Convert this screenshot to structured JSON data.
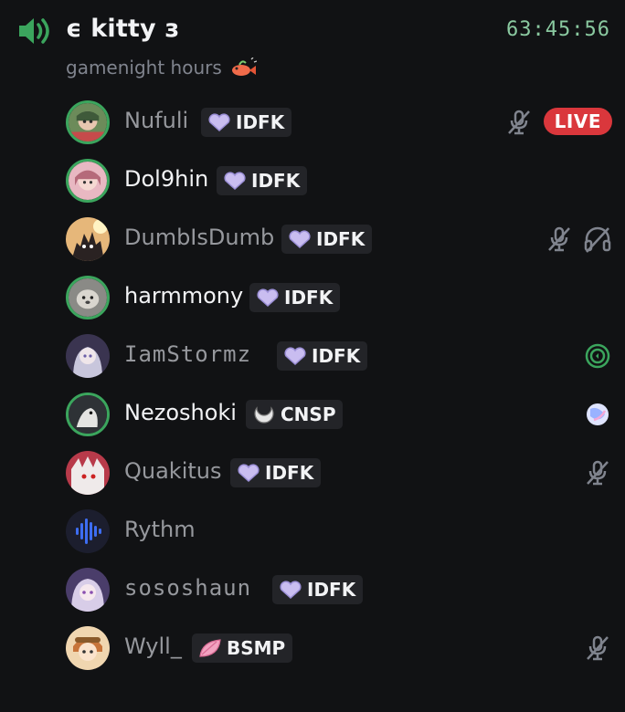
{
  "channel": {
    "name": "ϵ kitty з",
    "status": "gamenight hours",
    "timer": "63:45:56"
  },
  "users": [
    {
      "name": "Nufuli",
      "tag": "IDFK",
      "live": "LIVE"
    },
    {
      "name": "Dol9hin",
      "tag": "IDFK"
    },
    {
      "name": "DumbIsDumb",
      "tag": "IDFK"
    },
    {
      "name": "harmmony",
      "tag": "IDFK"
    },
    {
      "name": "IamStormz",
      "tag": "IDFK"
    },
    {
      "name": "Nezoshoki",
      "tag": "CNSP"
    },
    {
      "name": "Quakitus",
      "tag": "IDFK"
    },
    {
      "name": "Rythm"
    },
    {
      "name": "sososhaun",
      "tag": "IDFK"
    },
    {
      "name": "Wyll_",
      "tag": "BSMP"
    }
  ],
  "colors": {
    "background": "#111214",
    "speaking_ring": "#3ba55d",
    "live_badge": "#da373c",
    "timer": "#8ac9a0",
    "tag_heart": "#c9bdf0",
    "tag_bsmp": "#f2a2c0"
  },
  "icons": [
    "speaker-icon",
    "fish-emoji",
    "muted-mic-icon",
    "deafened-icon",
    "activity-icon",
    "orb-icon",
    "heart-badge-icon",
    "moon-badge-icon",
    "leaf-badge-icon"
  ]
}
